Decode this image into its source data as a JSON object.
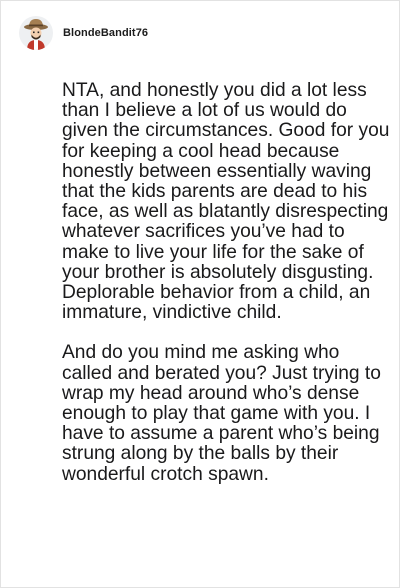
{
  "comment": {
    "username": "BlondeBandit76",
    "avatar_icon": "cowboy-hat-avatar-icon",
    "paragraphs": [
      "NTA, and honestly you did a lot less than I believe a lot of us would do given the circumstances. Good for you for keeping a cool head because honestly between essentially waving that the kids parents are dead to his face, as well as blatantly disrespecting whatever sacrifices you’ve had to make to live your life for the sake of your brother is absolutely disgusting. Deplorable behavior from a child, an immature, vindictive child.",
      "And do you mind me asking who called and berated you? Just trying to wrap my head around who’s dense enough to play that game with you. I have to assume a parent who’s being strung along by the balls by their wonderful crotch spawn."
    ]
  }
}
